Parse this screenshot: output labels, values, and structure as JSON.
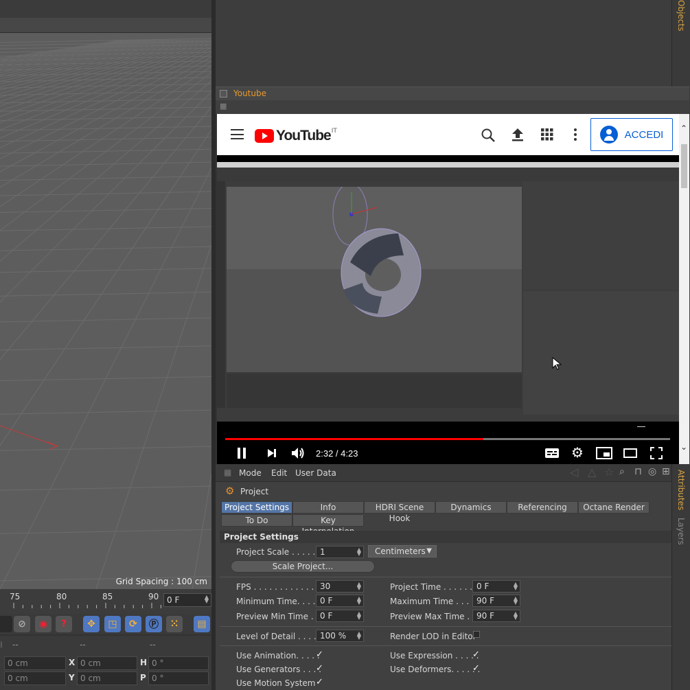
{
  "viewport": {
    "grid_spacing_label": "Grid Spacing : 100 cm",
    "icons": [
      "move-icon",
      "arrow-vertical-icon",
      "rotate-icon",
      "maximize-icon"
    ]
  },
  "timeline": {
    "ticks": [
      "75",
      "80",
      "85",
      "90"
    ],
    "current_frame": "0 F"
  },
  "coords": {
    "header": [
      "--",
      "--",
      "--"
    ],
    "rows": [
      {
        "v1": "0 cm",
        "l2": "X",
        "v2": "0 cm",
        "l3": "H",
        "v3": "0 °"
      },
      {
        "v1": "0 cm",
        "l2": "Y",
        "v2": "0 cm",
        "l3": "P",
        "v3": "0 °"
      }
    ]
  },
  "right_tabs": {
    "objects": "Objects",
    "attributes": "Attributes",
    "layers": "Layers"
  },
  "youtube_panel": {
    "title": "Youtube",
    "logo_text": "YouTube",
    "logo_sup": "IT",
    "signin_label": "ACCEDI",
    "time": "2:32 / 4:23",
    "progress": 0.58
  },
  "attributes": {
    "menu": [
      "Mode",
      "Edit",
      "User Data"
    ],
    "object_title": "Project",
    "tabs_row1": [
      "Project Settings",
      "Info",
      "HDRI Scene Hook",
      "Dynamics",
      "Referencing",
      "Octane Render"
    ],
    "tabs_row2": [
      "To Do",
      "Key Interpolation"
    ],
    "section_title": "Project Settings",
    "project_scale_label": "Project Scale . . . . . .",
    "project_scale_value": "1",
    "project_scale_unit": "Centimeters",
    "scale_button": "Scale Project...",
    "fps_label": "FPS . . . . . . . . . . . . . .",
    "fps_value": "30",
    "project_time_label": "Project Time . . . . . . . .",
    "project_time_value": "0 F",
    "min_time_label": "Minimum Time. . . . . . .",
    "min_time_value": "0 F",
    "max_time_label": "Maximum Time . . . . . .",
    "max_time_value": "90 F",
    "prev_min_label": "Preview Min Time . . . .",
    "prev_min_value": "0 F",
    "prev_max_label": "Preview Max Time . . .",
    "prev_max_value": "90 F",
    "lod_label": "Level of Detail . . . . .",
    "lod_value": "100 %",
    "render_lod_label": "Render LOD in Editor",
    "use_animation_label": "Use Animation. . . . .",
    "use_expression_label": "Use Expression . . . . .",
    "use_generators_label": "Use Generators . . . .",
    "use_deformers_label": "Use Deformers. . . . . .",
    "use_motion_label": "Use Motion System",
    "check": "✓"
  }
}
